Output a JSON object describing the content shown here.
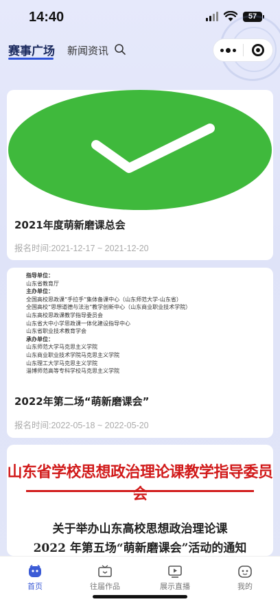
{
  "status_bar": {
    "time": "14:40",
    "battery": "57"
  },
  "nav": {
    "tab_active": "赛事广场",
    "tab_other": "新闻资讯"
  },
  "cards": [
    {
      "title": "2021年度萌新磨课总会",
      "date": "报名时间:2021-12-17 ~ 2021-12-20"
    },
    {
      "title": "2022年第二场“萌新磨课会”",
      "date": "报名时间:2022-05-18 ~ 2022-05-20",
      "doc_lines": [
        {
          "text": "指导单位：",
          "bold": true
        },
        {
          "text": "山东省教育厅",
          "bold": false
        },
        {
          "text": "主办单位：",
          "bold": true
        },
        {
          "text": "全国高校思政课“手拉手”集体备课中心（山东师范大学-山东省）",
          "bold": false
        },
        {
          "text": "全国高校“思想道德与法治”教学创新中心（山东商业职业技术学院）",
          "bold": false
        },
        {
          "text": "山东高校思政课教学指导委员会",
          "bold": false
        },
        {
          "text": "山东省大中小学思政课一体化建设指导中心",
          "bold": false
        },
        {
          "text": "山东省职业技术教育学会",
          "bold": false
        },
        {
          "text": "承办单位：",
          "bold": true
        },
        {
          "text": "山东师范大学马克思主义学院",
          "bold": false
        },
        {
          "text": "山东商业职业技术学院马克思主义学院",
          "bold": false
        },
        {
          "text": "山东理工大学马克思主义学院",
          "bold": false
        },
        {
          "text": "淄博师范高等专科学校马克思主义学院",
          "bold": false
        }
      ]
    },
    {
      "notice_head": "山东省学校思想政治理论课教学指导委员会",
      "notice_title_1": "关于举办山东高校思想政治理论课",
      "notice_title_2": "2022 年第五场“萌新磨课会”活动的通知"
    }
  ],
  "tabbar": [
    {
      "label": "首页",
      "icon": "home-icon",
      "active": true
    },
    {
      "label": "往届作品",
      "icon": "tv-icon",
      "active": false
    },
    {
      "label": "展示直播",
      "icon": "play-screen-icon",
      "active": false
    },
    {
      "label": "我的",
      "icon": "face-icon",
      "active": false
    }
  ],
  "colors": {
    "accent": "#2f52d8",
    "green": "#3fb93c",
    "red": "#d11a1a"
  }
}
